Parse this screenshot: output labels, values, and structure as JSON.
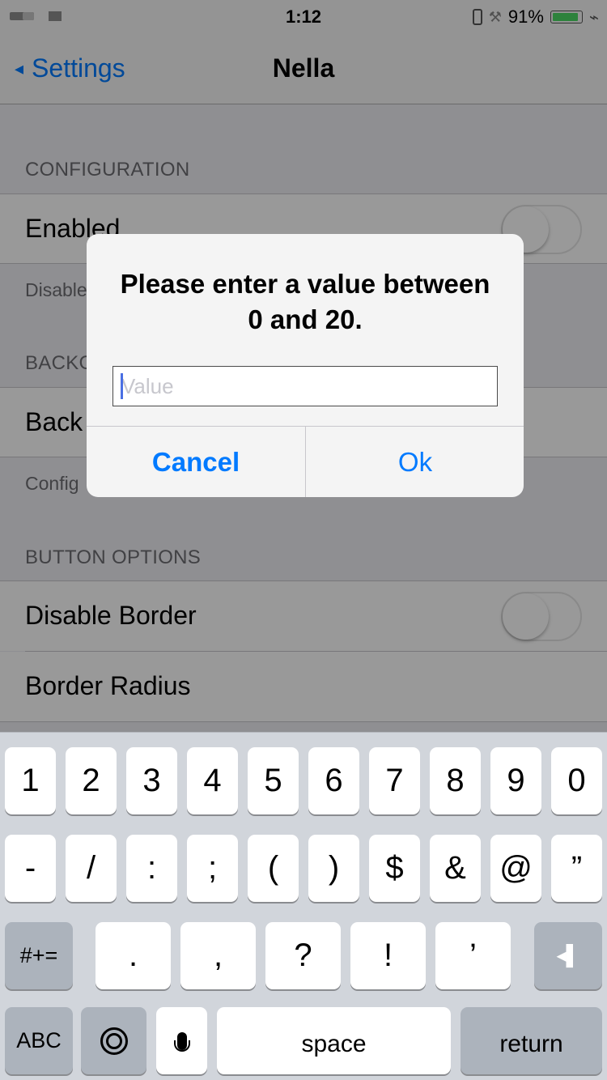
{
  "status_bar": {
    "time": "1:12",
    "battery_percent": "91%",
    "battery_level": 0.91,
    "battery_color": "#4cd964",
    "icons": [
      "signal-icon",
      "carrier-icon",
      "phone-icon",
      "tools-icon",
      "battery-icon",
      "charging-icon"
    ]
  },
  "nav": {
    "back_label": "Settings",
    "title": "Nella"
  },
  "settings": {
    "configuration_header": "CONFIGURATION",
    "enabled_label": "Enabled",
    "enabled_on": false,
    "enabled_footer": "Disable",
    "background_header": "BACKG",
    "background_label": "Back",
    "background_footer": "Config",
    "button_options_header": "BUTTON OPTIONS",
    "disable_border_label": "Disable Border",
    "disable_border_on": false,
    "border_radius_label": "Border Radius"
  },
  "alert": {
    "title_line1": "Please enter a value between",
    "title_line2": "0 and 20.",
    "input_placeholder": "Value",
    "input_value": "",
    "cancel_label": "Cancel",
    "ok_label": "Ok"
  },
  "keyboard": {
    "row1": [
      "1",
      "2",
      "3",
      "4",
      "5",
      "6",
      "7",
      "8",
      "9",
      "0"
    ],
    "row2": [
      "-",
      "/",
      ":",
      ";",
      "(",
      ")",
      "$",
      "&",
      "@",
      "”"
    ],
    "row3": [
      "#+=",
      ".",
      ",",
      "?",
      "!",
      "’"
    ],
    "abc_label": "ABC",
    "space_label": "space",
    "return_label": "return"
  },
  "colors": {
    "accent": "#007aff",
    "keyboard_bg": "#d1d5db",
    "dark_key": "#acb3bc"
  }
}
